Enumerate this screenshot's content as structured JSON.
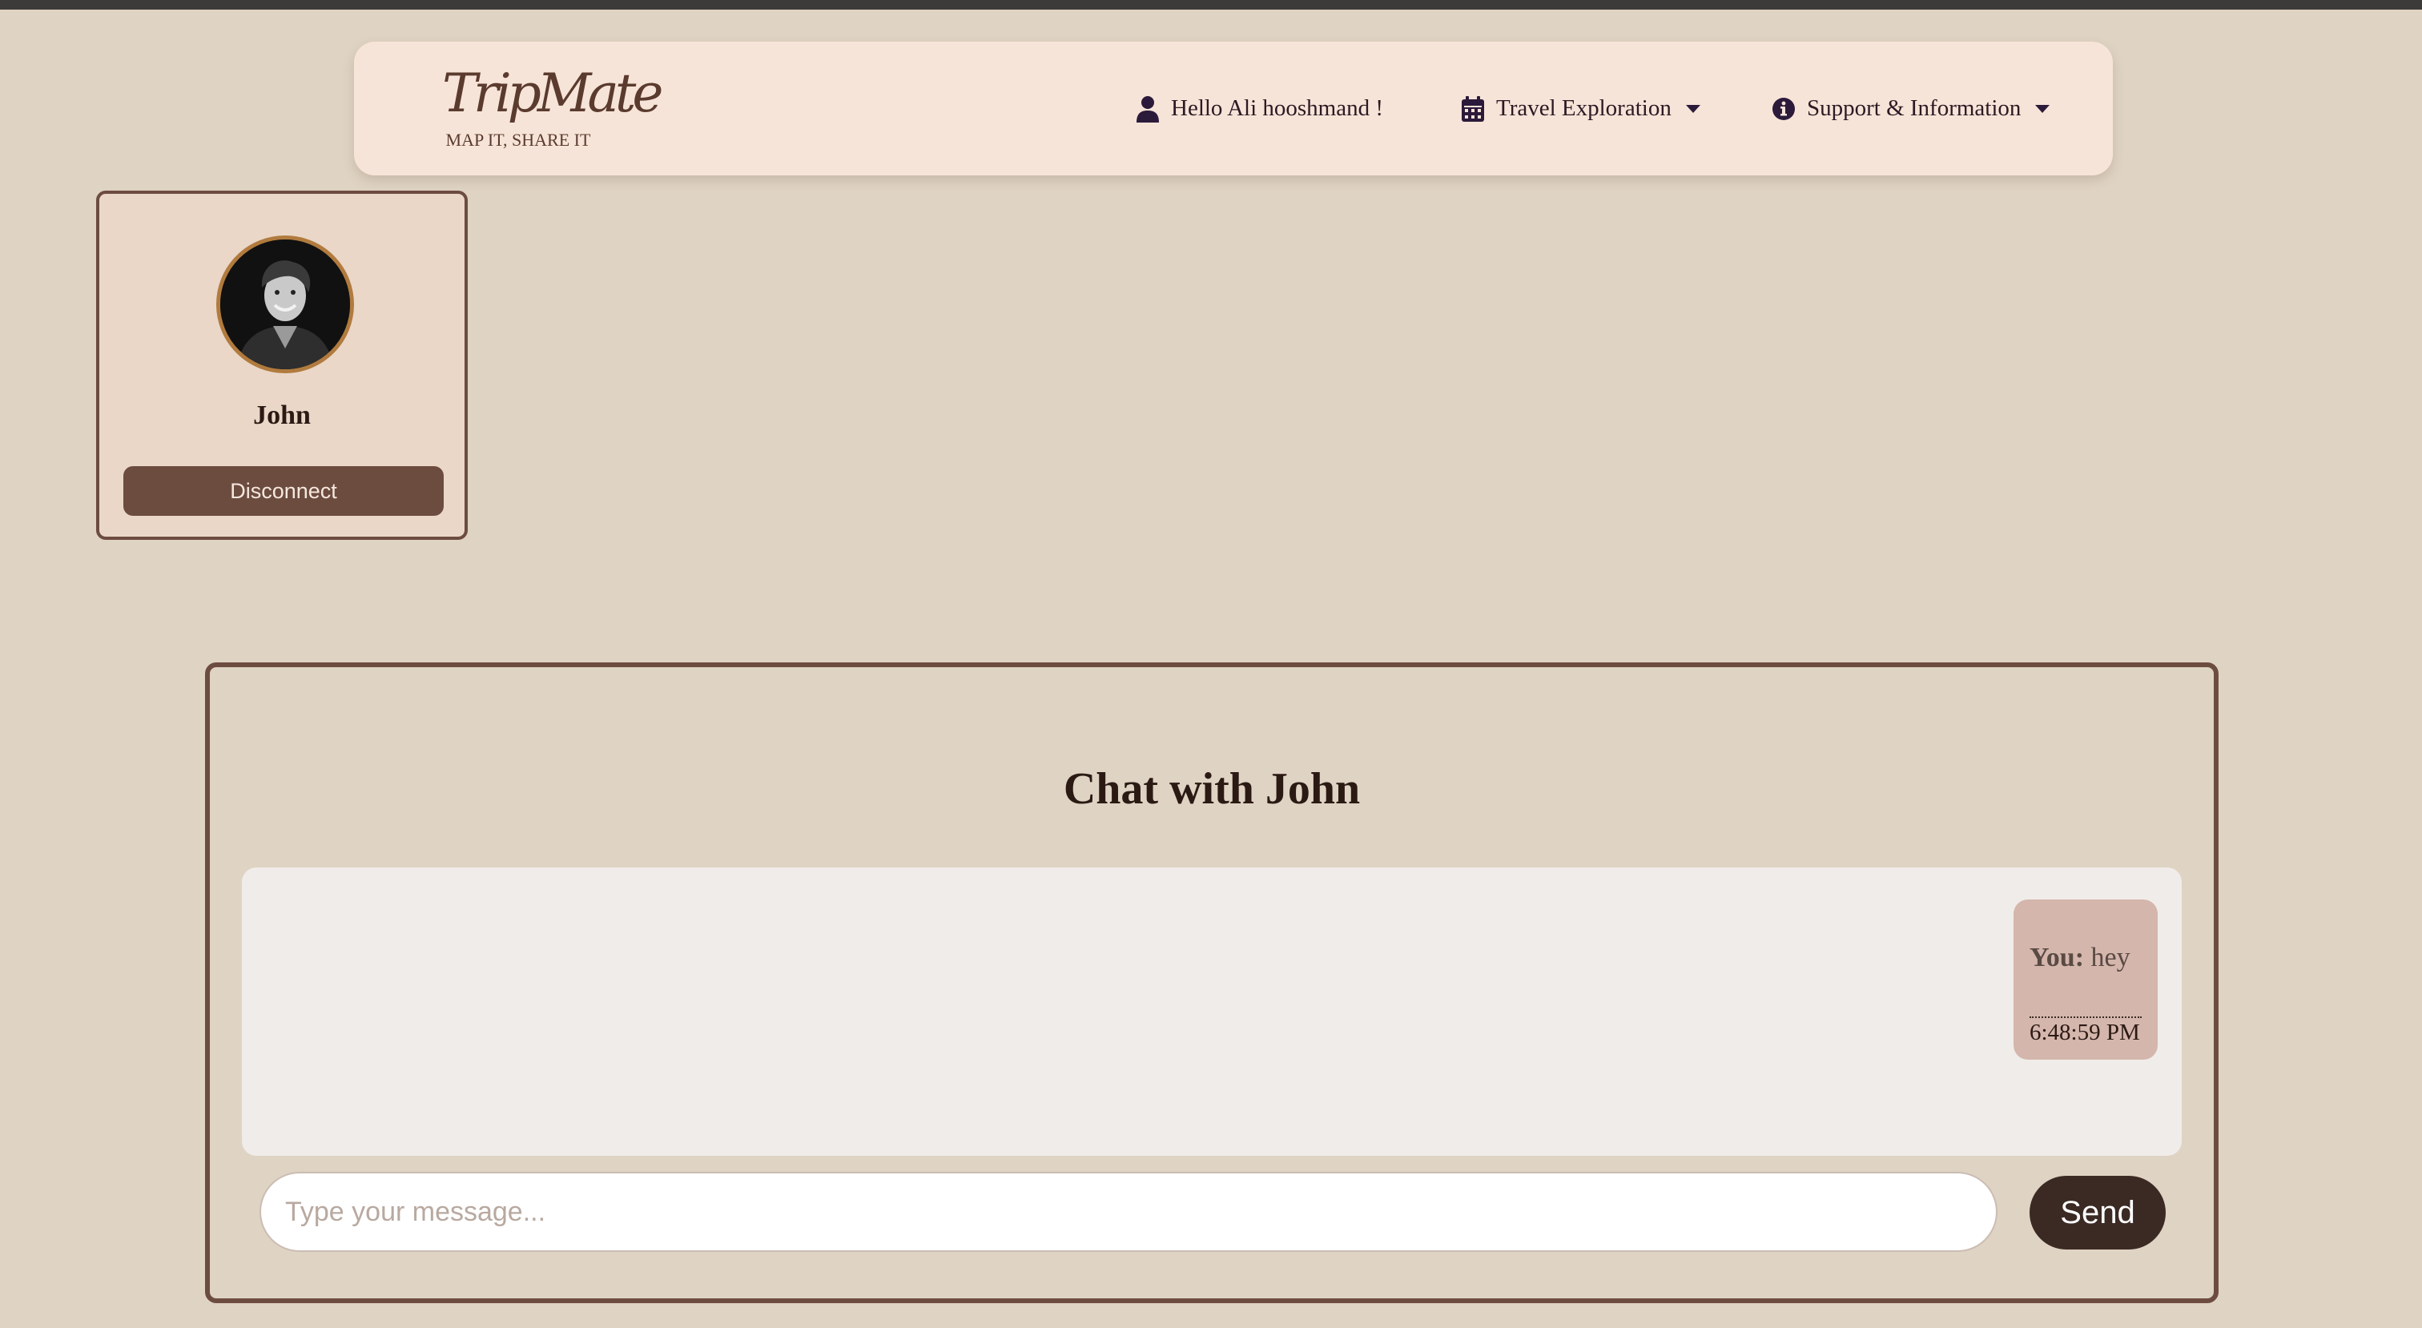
{
  "brand": {
    "logo_script": "TripMate",
    "tagline": "MAP IT, SHARE IT"
  },
  "nav": {
    "greeting": "Hello Ali hooshmand !",
    "greeting_icon": "user-icon",
    "travel_label": "Travel Exploration",
    "travel_icon": "calendar-icon",
    "support_label": "Support & Information",
    "support_icon": "info-circle-icon"
  },
  "connection": {
    "name": "John",
    "disconnect_label": "Disconnect"
  },
  "chat": {
    "title": "Chat with John",
    "messages": [
      {
        "sender": "You:",
        "text": "hey",
        "time": "6:48:59 PM"
      }
    ],
    "input_placeholder": "Type your message...",
    "send_label": "Send"
  },
  "colors": {
    "page_bg": "#dfd3c3",
    "navbar_bg": "#f7e4d8",
    "accent_brown": "#6d4c40",
    "send_button": "#3b2a24",
    "bubble_bg": "#d4b6ac"
  }
}
